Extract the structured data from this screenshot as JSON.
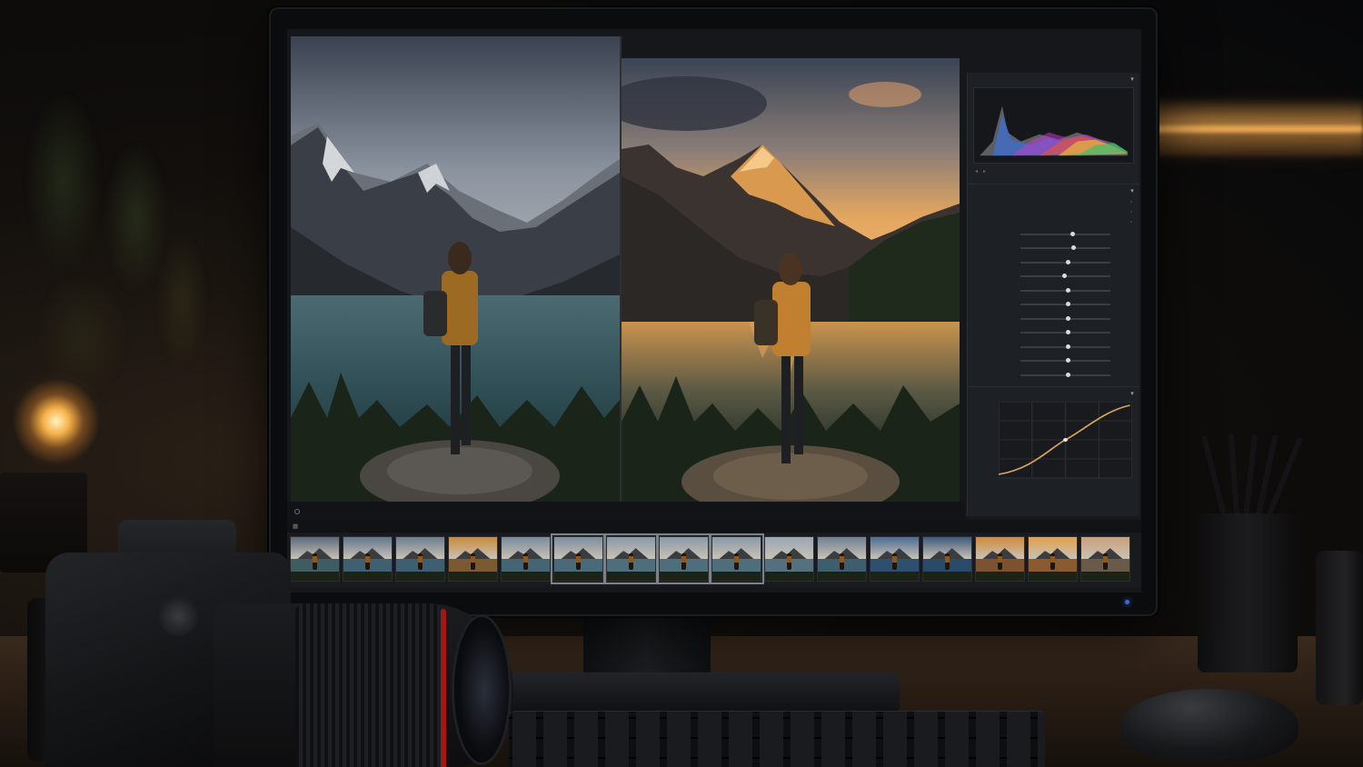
{
  "app": {
    "view_toolbar": [
      "",
      "",
      ""
    ],
    "zoom_label": "",
    "filmstrip_label": ""
  },
  "panel": {
    "histogram_title": "",
    "basic_title": "",
    "preset_rows": [
      "",
      "",
      ""
    ],
    "sliders": [
      {
        "label": "",
        "value": 0.56
      },
      {
        "label": "",
        "value": 0.57
      },
      {
        "label": "",
        "value": 0.5
      },
      {
        "label": "",
        "value": 0.46
      },
      {
        "label": "",
        "value": 0.5
      },
      {
        "label": "",
        "value": 0.5
      },
      {
        "label": "",
        "value": 0.5
      },
      {
        "label": "",
        "value": 0.5
      },
      {
        "label": "",
        "value": 0.5
      },
      {
        "label": "",
        "value": 0.5
      },
      {
        "label": "",
        "value": 0.5
      }
    ],
    "tone_curve_title": ""
  },
  "filmstrip": {
    "count": 16,
    "selected_indices": [
      5,
      6,
      7,
      8
    ],
    "thumb_palettes": [
      [
        "#5b6a7a",
        "#3f5c63"
      ],
      [
        "#62768a",
        "#405f70"
      ],
      [
        "#6c7c8c",
        "#3d5f6f"
      ],
      [
        "#c98b3c",
        "#7a5a32"
      ],
      [
        "#7a8a9a",
        "#456575"
      ],
      [
        "#7d8d9d",
        "#4a6a7a"
      ],
      [
        "#8a98a6",
        "#4e6e7c"
      ],
      [
        "#8a98a6",
        "#4e6e7c"
      ],
      [
        "#8a98a6",
        "#4e6e7c"
      ],
      [
        "#9aa6b2",
        "#55707e"
      ],
      [
        "#6f8090",
        "#3e5d6d"
      ],
      [
        "#4d6c93",
        "#2f4f6f"
      ],
      [
        "#3d5a7a",
        "#294a68"
      ],
      [
        "#d08a3a",
        "#7d5230"
      ],
      [
        "#e0a04a",
        "#8a5a30"
      ],
      [
        "#c9a07a",
        "#6a5a4a"
      ]
    ]
  },
  "colors": {
    "panel_bg": "#1d2024",
    "screen_bg": "#15171a",
    "accent_warm": "#e7a653",
    "power_led": "#3b6ad6"
  }
}
